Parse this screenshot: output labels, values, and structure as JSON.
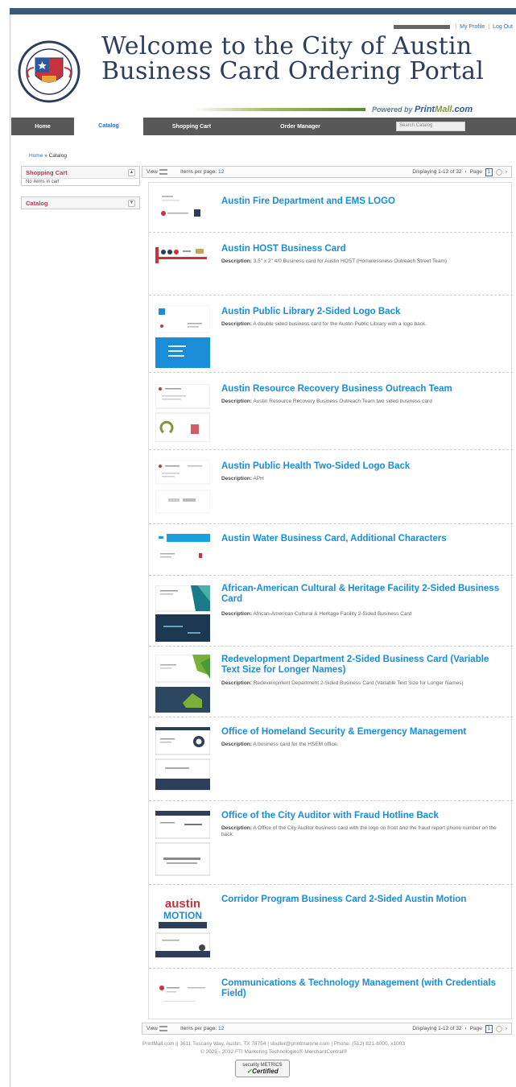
{
  "header": {
    "user_links": [
      "My Profile",
      "Log Out"
    ],
    "title_line1": "Welcome to the City of Austin",
    "title_line2": "Business Card Ordering Portal",
    "powered_label": "Powered by",
    "powered_brand_a": "Print",
    "powered_brand_b": "Mall",
    "powered_brand_c": ".com"
  },
  "nav": {
    "items": [
      "Home",
      "Catalog",
      "Shopping Cart",
      "Order Manager"
    ],
    "active": "Catalog",
    "search_placeholder": "Search Catalog"
  },
  "breadcrumb": {
    "home": "Home",
    "sep": " » ",
    "current": "Catalog"
  },
  "sidebar": {
    "cart_title": "Shopping Cart",
    "cart_empty": "No items in cart",
    "catalog_title": "Catalog"
  },
  "pager": {
    "view_label": "View",
    "perpage_label": "Items per page:",
    "perpage_value": "12",
    "displaying": "Displaying 1-12 of 32",
    "page_label": "Page",
    "current_page": "1"
  },
  "products": [
    {
      "title": "Austin Fire Department and EMS LOGO",
      "desc": ""
    },
    {
      "title": "Austin HOST Business Card",
      "desc": "3.5\" x 2\" 4/0 Business card for Austin HOST (Homelessness Outreach Street Team)"
    },
    {
      "title": "Austin Public Library 2-Sided Logo Back",
      "desc": "A double sided business card for the Austin Public Library with a logo back."
    },
    {
      "title": "Austin Resource Recovery Business Outreach Team",
      "desc": "Austin Resource Recovery Business Outreach Team two sided business card"
    },
    {
      "title": "Austin Public Health Two-Sided Logo Back",
      "desc": "APH"
    },
    {
      "title": "Austin Water Business Card, Additional Characters",
      "desc": ""
    },
    {
      "title": "African-American Cultural & Heritage Facility 2-Sided Business Card",
      "desc": "African-American Cultural & Heritage Facility 2-Sided Business Card"
    },
    {
      "title": "Redevelopment Department 2-Sided Business Card (Variable Text Size for Longer Names)",
      "desc": "Redevelopment Department 2-Sided Business Card (Variable Text Size for Longer Names)"
    },
    {
      "title": "Office of Homeland Security & Emergency Management",
      "desc": "A business card for the HSEM office."
    },
    {
      "title": "Office of the City Auditor with Fraud Hotline Back",
      "desc": "A Office of the City Auditor business card with the logo on front and the fraud report phone number on the back."
    },
    {
      "title": "Corridor Program Business Card 2-Sided Austin Motion",
      "desc": ""
    },
    {
      "title": "Communications & Technology Management (with Credentials Field)",
      "desc": ""
    }
  ],
  "desc_label": "Description:",
  "footer": {
    "line1": "PrintMall.com || 3611 Tuscany Way, Austin, TX 78754 | sbuller@printmalone.com | Phone: (512) 821-8000, x1003",
    "line2": "© 2025 - 2032 FTI Marketing Technologies® MerchantCentral®",
    "badge_top": "security METRICS",
    "badge_bottom": "Certified"
  },
  "colors": {
    "nav_bg": "#585858",
    "link": "#1a8cd8",
    "title": "#2c3e5a",
    "accent_red": "#b04050"
  }
}
